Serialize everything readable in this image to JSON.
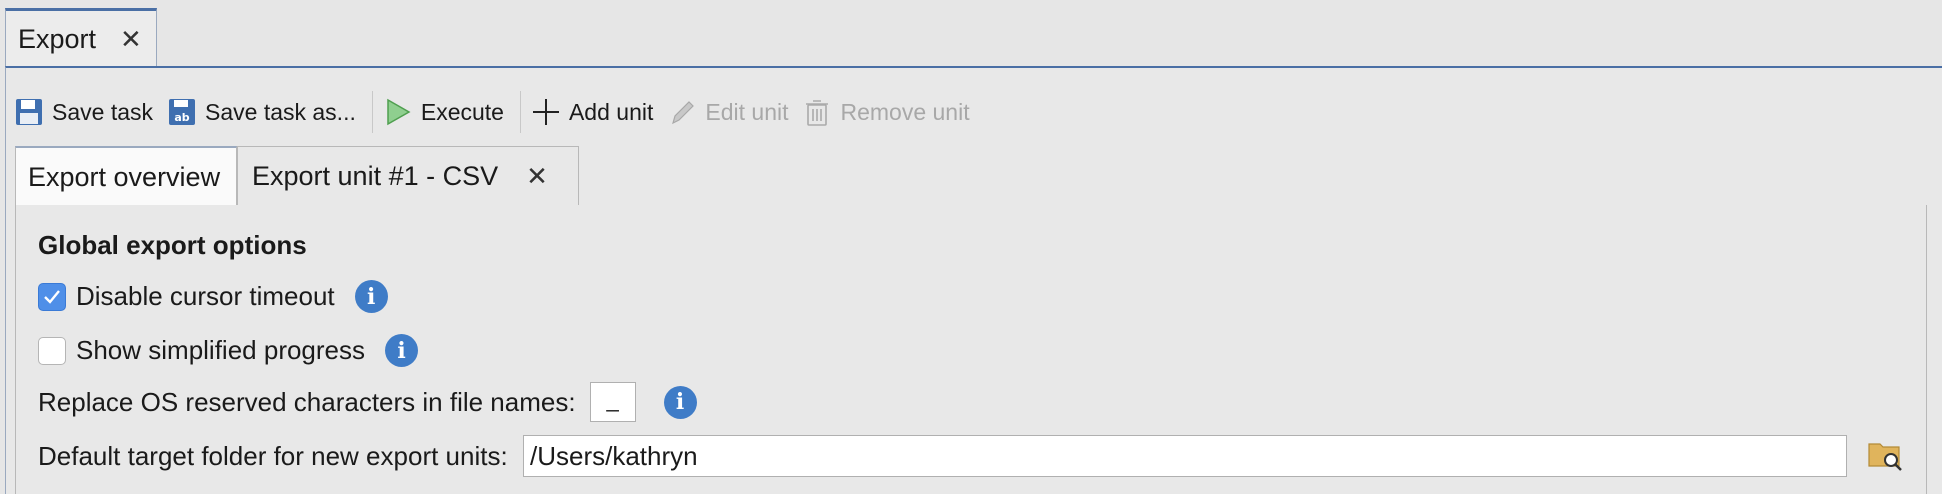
{
  "window_tab": {
    "label": "Export",
    "close": "✕"
  },
  "toolbar": {
    "save_task": "Save task",
    "save_task_as": "Save task as...",
    "execute": "Execute",
    "add_unit": "Add unit",
    "edit_unit": "Edit unit",
    "remove_unit": "Remove unit"
  },
  "tabs": [
    {
      "label": "Export overview",
      "active": true
    },
    {
      "label": "Export unit #1 - CSV",
      "close": "✕"
    }
  ],
  "options": {
    "heading": "Global export options",
    "disable_cursor_timeout": {
      "label": "Disable cursor timeout",
      "checked": true
    },
    "show_simplified_progress": {
      "label": "Show simplified progress",
      "checked": false
    },
    "replace_os_chars": {
      "label": "Replace OS reserved characters in file names:",
      "value": "_"
    },
    "default_target_folder": {
      "label": "Default target folder for new export units:",
      "value": "/Users/kathryn"
    },
    "info_glyph": "i"
  },
  "colors": {
    "accent": "#4a6fa5",
    "info": "#3f7cc7",
    "checkbox": "#4f8fe8",
    "disabled_text": "#a8a8a8"
  }
}
